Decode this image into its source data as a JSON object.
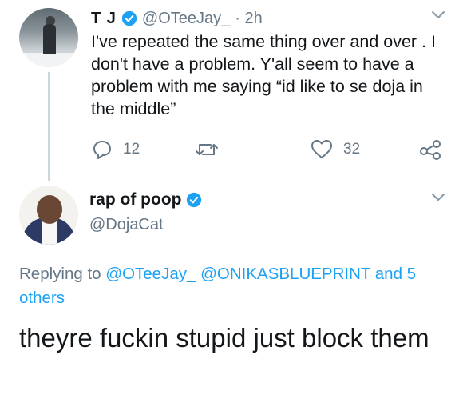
{
  "tweet_original": {
    "author_name": "T J",
    "author_handle": "@OTeeJay_",
    "timestamp": "· 2h",
    "text": "I've repeated the same thing over and over . I don't have a problem. Y'all seem to have a problem with me saying “id like to se doja in the middle”",
    "replies_count": "12",
    "likes_count": "32",
    "icons": {
      "verified": "verified-badge-icon",
      "menu": "chevron-down-icon",
      "reply": "reply-icon",
      "retweet": "retweet-icon",
      "like": "heart-icon",
      "share": "share-icon"
    }
  },
  "tweet_reply": {
    "author_name": "rap of poop",
    "author_handle": "@DojaCat",
    "replying_prefix": "Replying to",
    "replying_to_1": "@OTeeJay_",
    "replying_to_2": "@ONIKASBLUEPRINT",
    "replying_more": "and 5 others",
    "text": "theyre fuckin stupid just block them"
  },
  "colors": {
    "text": "#14171a",
    "secondary": "#657786",
    "accent": "#1da1f2",
    "thread_line": "#ccd6dd"
  }
}
